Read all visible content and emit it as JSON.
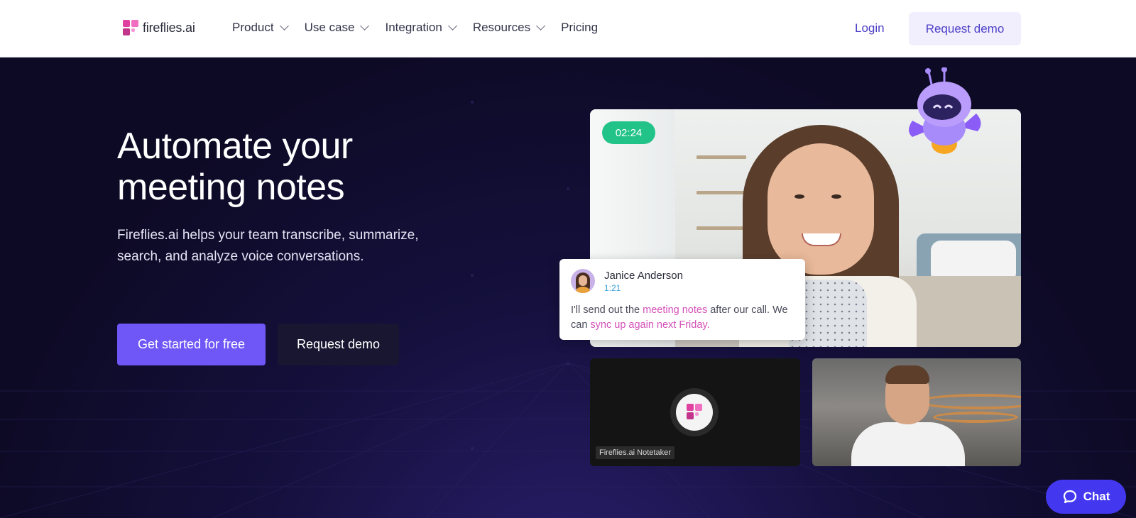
{
  "nav": {
    "logo_text": "fireflies.ai",
    "menu": [
      {
        "label": "Product",
        "has_dropdown": true
      },
      {
        "label": "Use case",
        "has_dropdown": true
      },
      {
        "label": "Integration",
        "has_dropdown": true
      },
      {
        "label": "Resources",
        "has_dropdown": true
      },
      {
        "label": "Pricing",
        "has_dropdown": false
      }
    ],
    "login_label": "Login",
    "request_demo_label": "Request demo"
  },
  "hero": {
    "headline_line1": "Automate your",
    "headline_line2": "meeting notes",
    "subtitle": "Fireflies.ai helps your team transcribe, summarize, search, and analyze voice conversations.",
    "primary_cta": "Get started for free",
    "secondary_cta": "Request demo"
  },
  "video": {
    "timer": "02:24",
    "transcript": {
      "speaker": "Janice Anderson",
      "time": "1:21",
      "text_part1": "I'll send out the ",
      "highlight1": "meeting notes",
      "text_part2": " after our call. We can ",
      "highlight2": "sync up again next Friday."
    },
    "notetaker_label": "Fireflies.ai Notetaker"
  },
  "chat": {
    "label": "Chat"
  },
  "colors": {
    "accent": "#6e56f7",
    "brand_link": "#4b3ec7",
    "hero_bg": "#0d0a25",
    "timer_green": "#22c389",
    "highlight_pink": "#d451b9",
    "chat_blue": "#4338f0"
  },
  "icons": [
    "fireflies-logo-icon",
    "chevron-down-icon",
    "robot-mascot-icon",
    "chat-bubble-icon"
  ]
}
